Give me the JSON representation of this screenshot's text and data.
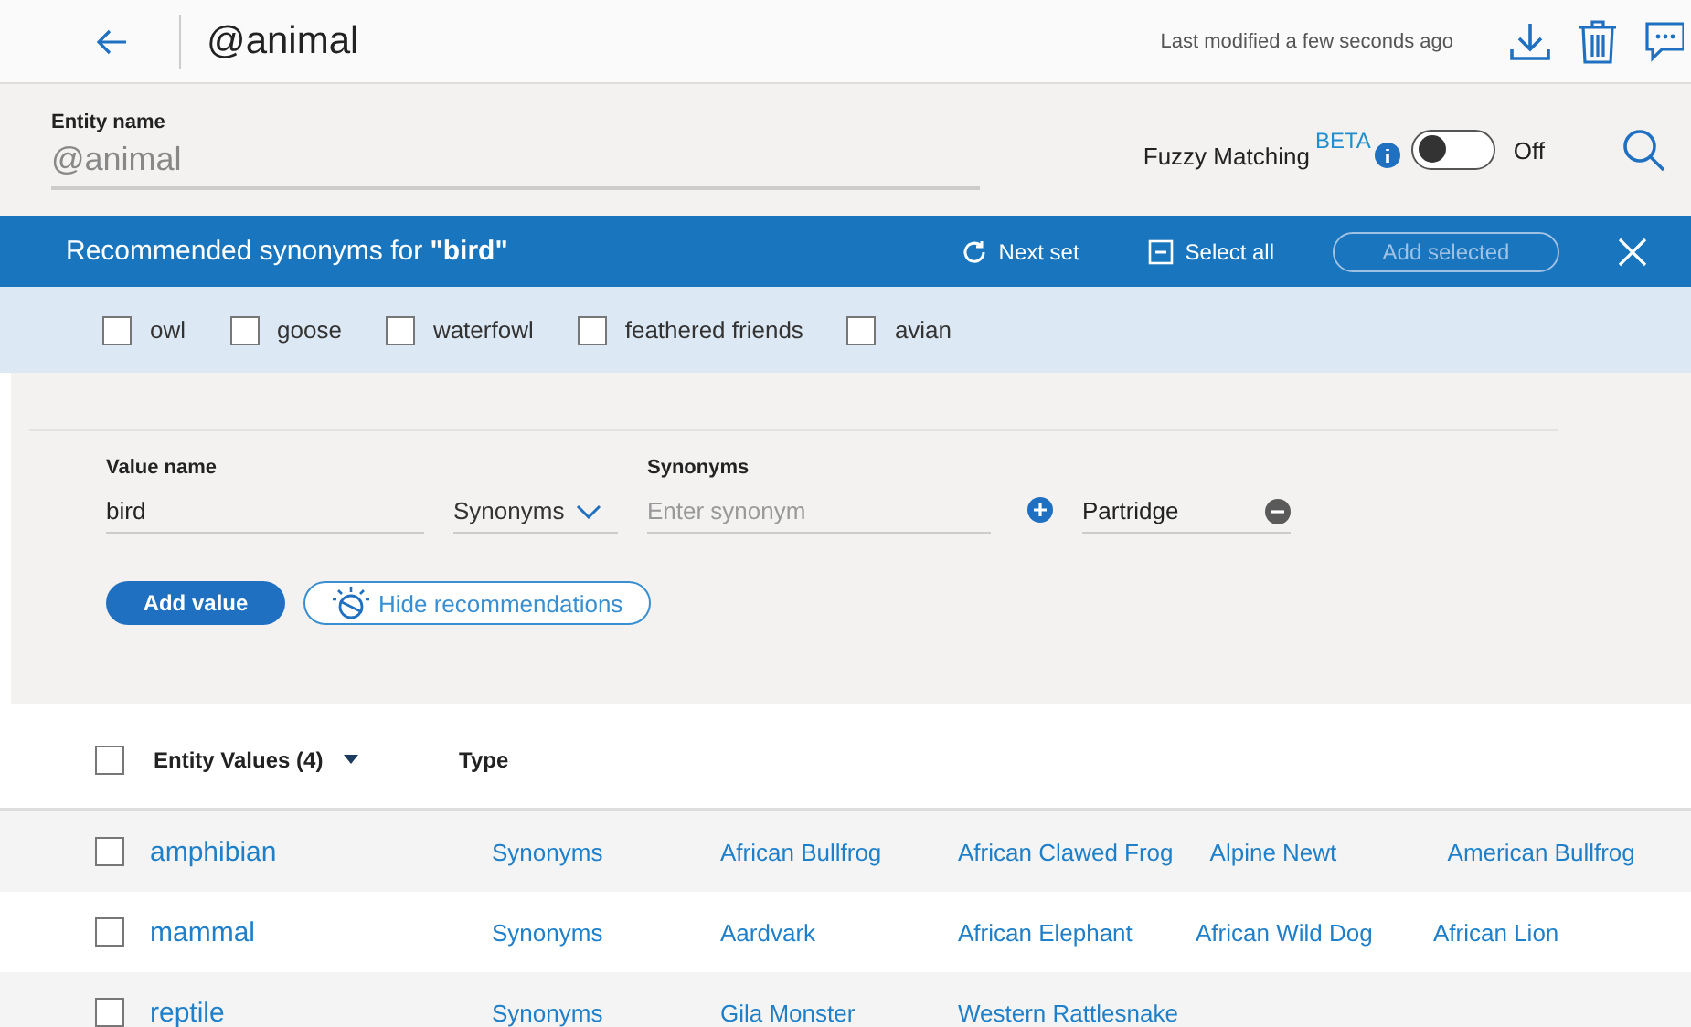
{
  "header": {
    "title": "@animal",
    "modified": "Last modified a few seconds ago"
  },
  "entity": {
    "label": "Entity name",
    "value": "@animal",
    "fuzzy_label": "Fuzzy Matching",
    "fuzzy_badge": "BETA",
    "fuzzy_on": false,
    "fuzzy_state": "Off"
  },
  "recommendations": {
    "title": "Recommended synonyms for **\"bird\"**",
    "next_set": "Next set",
    "select_all": "Select all",
    "add_selected": "Add selected",
    "add_selected_disabled": true,
    "items": [
      {
        "label": "owl",
        "checked": false
      },
      {
        "label": "goose",
        "checked": false
      },
      {
        "label": "waterfowl",
        "checked": false
      },
      {
        "label": "feathered friends",
        "checked": false
      },
      {
        "label": "avian",
        "checked": false
      }
    ]
  },
  "value_form": {
    "value_label": "Value name",
    "value": "bird",
    "type": "Synonyms",
    "synonyms_label": "Synonyms",
    "synonym_placeholder": "Enter synonym",
    "synonyms": [
      "Partridge"
    ],
    "add_value": "Add value",
    "hide_recommendations": "Hide recommendations"
  },
  "table": {
    "columns": [
      "Entity Values (4)",
      "Type"
    ],
    "all_checked": false,
    "rows": [
      {
        "name": "amphibian",
        "type": "Synonyms",
        "checked": false,
        "values": [
          "African Bullfrog",
          "African Clawed Frog",
          "Alpine Newt",
          "American Bullfrog"
        ]
      },
      {
        "name": "mammal",
        "type": "Synonyms",
        "checked": false,
        "values": [
          "Aardvark",
          "African Elephant",
          "African Wild Dog",
          "African Lion"
        ]
      },
      {
        "name": "reptile",
        "type": "Synonyms",
        "checked": false,
        "values": [
          "Gila Monster",
          "Western Rattlesnake"
        ]
      }
    ]
  }
}
